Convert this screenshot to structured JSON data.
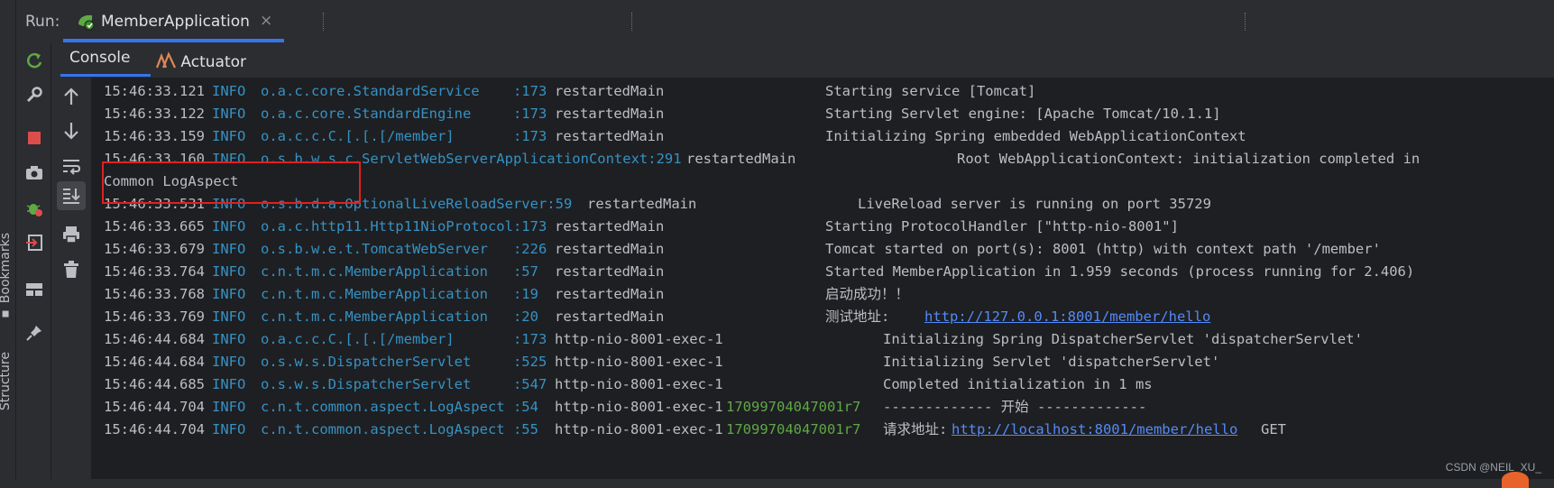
{
  "sidebar_tabs": {
    "bookmarks": "Bookmarks",
    "structure": "Structure"
  },
  "run": {
    "label": "Run:",
    "tab_title": "MemberApplication",
    "close_glyph": "×"
  },
  "subtabs": {
    "console": "Console",
    "actuator": "Actuator"
  },
  "icons": {
    "left_tools": [
      "rerun-icon",
      "wrench-icon",
      "stop-icon",
      "camera-icon",
      "debug-icon",
      "exit-icon",
      "layout-icon",
      "pin-icon"
    ],
    "console_tools": [
      "arrow-up-icon",
      "arrow-down-icon",
      "soft-wrap-icon",
      "scroll-to-end-icon",
      "print-icon",
      "trash-icon"
    ]
  },
  "colors": {
    "accent": "#3574f0",
    "info": "#3592c4",
    "link": "#548af7",
    "highlight_box": "#e02020",
    "trace_id": "#5fa846"
  },
  "console": {
    "lines": [
      {
        "ts": "15:46:33.121",
        "level": "INFO",
        "logger": "o.a.c.core.StandardService    :173",
        "thread": "restartedMain",
        "message": "Starting service [Tomcat]"
      },
      {
        "ts": "15:46:33.122",
        "level": "INFO",
        "logger": "o.a.c.core.StandardEngine     :173",
        "thread": "restartedMain",
        "message": "Starting Servlet engine: [Apache Tomcat/10.1.1]"
      },
      {
        "ts": "15:46:33.159",
        "level": "INFO",
        "logger": "o.a.c.c.C.[.[.[/member]       :173",
        "thread": "restartedMain",
        "message": "Initializing Spring embedded WebApplicationContext"
      },
      {
        "ts": "15:46:33.160",
        "level": "INFO",
        "logger": "o.s.b.w.s.c.ServletWebServerApplicationContext:291",
        "thread": "restartedMain",
        "message": "Root WebApplicationContext: initialization completed in"
      },
      {
        "plain": "Common LogAspect"
      },
      {
        "ts": "15:46:33.531",
        "level": "INFO",
        "logger": "o.s.b.d.a.OptionalLiveReloadServer:59",
        "thread": "restartedMain",
        "message": "LiveReload server is running on port 35729"
      },
      {
        "ts": "15:46:33.665",
        "level": "INFO",
        "logger": "o.a.c.http11.Http11NioProtocol:173",
        "thread": "restartedMain",
        "message": "Starting ProtocolHandler [\"http-nio-8001\"]"
      },
      {
        "ts": "15:46:33.679",
        "level": "INFO",
        "logger": "o.s.b.w.e.t.TomcatWebServer   :226",
        "thread": "restartedMain",
        "message": "Tomcat started on port(s): 8001 (http) with context path '/member'"
      },
      {
        "ts": "15:46:33.764",
        "level": "INFO",
        "logger": "c.n.t.m.c.MemberApplication   :57",
        "thread": "restartedMain",
        "message": "Started MemberApplication in 1.959 seconds (process running for 2.406)"
      },
      {
        "ts": "15:46:33.768",
        "level": "INFO",
        "logger": "c.n.t.m.c.MemberApplication   :19",
        "thread": "restartedMain",
        "message": "启动成功！！"
      },
      {
        "ts": "15:46:33.769",
        "level": "INFO",
        "logger": "c.n.t.m.c.MemberApplication   :20",
        "thread": "restartedMain",
        "message": "测试地址:",
        "link": "http://127.0.0.1:8001/member/hello"
      },
      {
        "ts": "15:46:44.684",
        "level": "INFO",
        "logger": "o.a.c.c.C.[.[.[/member]       :173",
        "thread": "http-nio-8001-exec-1",
        "message": "Initializing Spring DispatcherServlet 'dispatcherServlet'"
      },
      {
        "ts": "15:46:44.684",
        "level": "INFO",
        "logger": "o.s.w.s.DispatcherServlet     :525",
        "thread": "http-nio-8001-exec-1",
        "message": "Initializing Servlet 'dispatcherServlet'"
      },
      {
        "ts": "15:46:44.685",
        "level": "INFO",
        "logger": "o.s.w.s.DispatcherServlet     :547",
        "thread": "http-nio-8001-exec-1",
        "message": "Completed initialization in 1 ms"
      },
      {
        "ts": "15:46:44.704",
        "level": "INFO",
        "logger": "c.n.t.common.aspect.LogAspect :54",
        "thread": "http-nio-8001-exec-1",
        "trace": "17099704047001r7",
        "message": "------------- 开始 -------------"
      },
      {
        "ts": "15:46:44.704",
        "level": "INFO",
        "logger": "c.n.t.common.aspect.LogAspect :55",
        "thread": "http-nio-8001-exec-1",
        "trace": "17099704047001r7",
        "message": "请求地址:",
        "link": "http://localhost:8001/member/hello",
        "suffix": "GET"
      }
    ]
  },
  "watermark": "CSDN @NEIL_XU_"
}
